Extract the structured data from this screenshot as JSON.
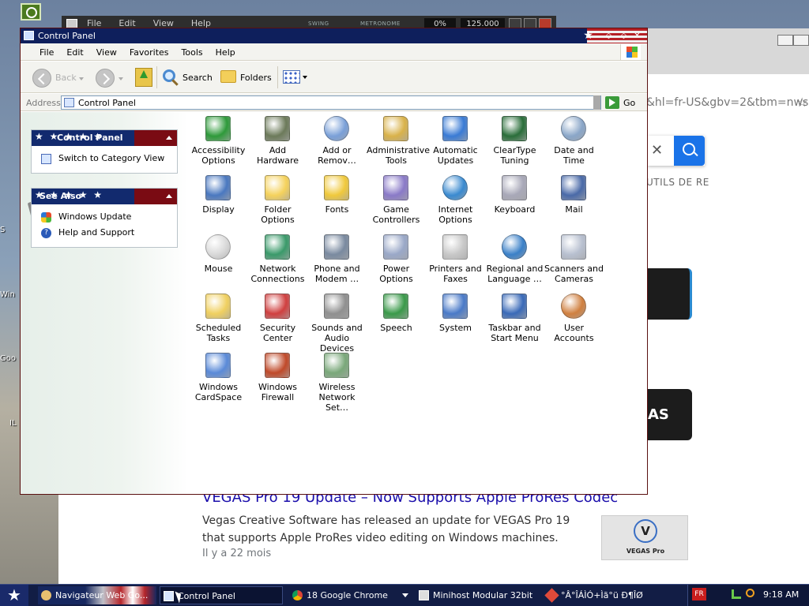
{
  "background_windows": {
    "music_app": {
      "menu": [
        "File",
        "Edit",
        "View",
        "Help"
      ],
      "swing_label": "SWING",
      "metronome_label": "METRONOME",
      "percent": "0%",
      "tempo": "125.000"
    },
    "browser": {
      "url_fragment": "&hl=fr-US&gbv=2&tbm=nws",
      "tools_label": "UTILS DE RE",
      "thumb_text": "AS",
      "news": {
        "title": "VEGAS Pro 19 Update – Now Supports Apple ProRes Codec",
        "body": "Vegas Creative Software has released an update for VEGAS Pro 19 that supports Apple ProRes video editing on Windows machines.",
        "meta": "Il y a 22 mois",
        "thumb_letter": "V",
        "thumb_caption": "VEGAS Pro"
      }
    },
    "desktop_labels": [
      "S",
      "Win",
      "Goo",
      "IL"
    ]
  },
  "window": {
    "title": "Control Panel",
    "menu": [
      "File",
      "Edit",
      "View",
      "Favorites",
      "Tools",
      "Help"
    ],
    "toolbar": {
      "back": "Back",
      "search": "Search",
      "folders": "Folders"
    },
    "address": {
      "label": "Address",
      "value": "Control Panel",
      "go": "Go"
    },
    "left_panels": [
      {
        "title": "Control Panel",
        "items": [
          "Switch to Category View"
        ]
      },
      {
        "title": "See Also",
        "items": [
          "Windows Update",
          "Help and Support"
        ]
      }
    ],
    "items": [
      {
        "label": "Accessibility Options",
        "icon": "accessibility-icon",
        "color": "#2e9a3a"
      },
      {
        "label": "Add Hardware",
        "icon": "hardware-icon",
        "color": "#6c7a5a"
      },
      {
        "label": "Add or Remov…",
        "icon": "cd-icon",
        "color": "#7aa0d8"
      },
      {
        "label": "Administrative Tools",
        "icon": "tools-folder-icon",
        "color": "#d9b24a"
      },
      {
        "label": "Automatic Updates",
        "icon": "windows-flag-icon",
        "color": "#3a7bd5"
      },
      {
        "label": "ClearType Tuning",
        "icon": "cleartype-icon",
        "color": "#2a6e3a"
      },
      {
        "label": "Date and Time",
        "icon": "clock-icon",
        "color": "#8aa6c8"
      },
      {
        "label": "Display",
        "icon": "monitor-icon",
        "color": "#4a78c0"
      },
      {
        "label": "Folder Options",
        "icon": "folder-icon",
        "color": "#f5d25c"
      },
      {
        "label": "Fonts",
        "icon": "fonts-folder-icon",
        "color": "#f0c93c"
      },
      {
        "label": "Game Controllers",
        "icon": "gamepad-icon",
        "color": "#8a7ac8"
      },
      {
        "label": "Internet Options",
        "icon": "globe-icon",
        "color": "#3a8ad0"
      },
      {
        "label": "Keyboard",
        "icon": "keyboard-icon",
        "color": "#a8a8b8"
      },
      {
        "label": "Mail",
        "icon": "mail-icon",
        "color": "#4a6aa8"
      },
      {
        "label": "Mouse",
        "icon": "mouse-icon",
        "color": "#d8d8d8"
      },
      {
        "label": "Network Connections",
        "icon": "network-icon",
        "color": "#3a9a6a"
      },
      {
        "label": "Phone and Modem …",
        "icon": "phone-icon",
        "color": "#7a8aa0"
      },
      {
        "label": "Power Options",
        "icon": "power-icon",
        "color": "#9aa8c8"
      },
      {
        "label": "Printers and Faxes",
        "icon": "printer-icon",
        "color": "#c8c8c8"
      },
      {
        "label": "Regional and Language …",
        "icon": "regional-globe-icon",
        "color": "#3a80c8"
      },
      {
        "label": "Scanners and Cameras",
        "icon": "scanner-icon",
        "color": "#b8c0d0"
      },
      {
        "label": "Scheduled Tasks",
        "icon": "scheduled-folder-icon",
        "color": "#f0d060"
      },
      {
        "label": "Security Center",
        "icon": "shield-icon",
        "color": "#d04040"
      },
      {
        "label": "Sounds and Audio Devices",
        "icon": "speaker-icon",
        "color": "#909090"
      },
      {
        "label": "Speech",
        "icon": "speech-icon",
        "color": "#3a9a4a"
      },
      {
        "label": "System",
        "icon": "system-icon",
        "color": "#4a7ac8"
      },
      {
        "label": "Taskbar and Start Menu",
        "icon": "taskbar-icon",
        "color": "#3a6ab8"
      },
      {
        "label": "User Accounts",
        "icon": "users-icon",
        "color": "#d08040"
      },
      {
        "label": "Windows CardSpace",
        "icon": "cardspace-icon",
        "color": "#5a8ad8"
      },
      {
        "label": "Windows Firewall",
        "icon": "firewall-icon",
        "color": "#c04a2a"
      },
      {
        "label": "Wireless Network Set…",
        "icon": "wireless-icon",
        "color": "#7aa87a"
      }
    ]
  },
  "taskbar": {
    "items": [
      {
        "label": "Navigateur Web Go...",
        "icon": "browser-icon"
      },
      {
        "label": "Control Panel",
        "icon": "control-panel-icon"
      },
      {
        "label": "18 Google Chrome",
        "icon": "chrome-icon"
      },
      {
        "label": "Minihost Modular 32bit",
        "icon": "music-app-icon"
      },
      {
        "label": "°Â°ÎÁÌÓ+Ìã°ü  Ð¶ÎØ",
        "icon": "app-icon"
      }
    ],
    "language": "FR",
    "time": "9:18 AM"
  }
}
